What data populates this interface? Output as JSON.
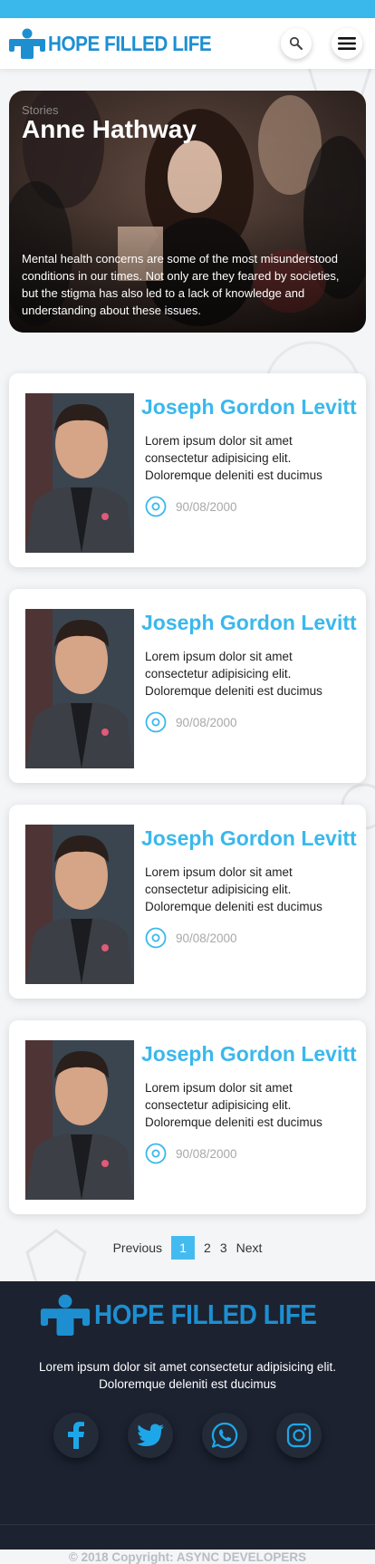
{
  "header": {
    "logo_text": "HOPE FILLED LIFE",
    "search_icon": "search-icon",
    "menu_icon": "hamburger-menu-icon"
  },
  "hero": {
    "kicker": "Stories",
    "title": "Anne Hathway",
    "description": "Mental health concerns are some of the most misunderstood conditions in our times. Not only are they feared by societies, but the stigma has also led to a lack of knowledge and understanding about these issues."
  },
  "cards": [
    {
      "name": "Joseph Gordon Levitt",
      "text": "Lorem ipsum dolor sit amet consectetur adipisicing elit. Doloremque deleniti est ducimus",
      "date": "90/08/2000"
    },
    {
      "name": "Joseph Gordon Levitt",
      "text": "Lorem ipsum dolor sit amet consectetur adipisicing elit. Doloremque deleniti est ducimus",
      "date": "90/08/2000"
    },
    {
      "name": "Joseph Gordon Levitt",
      "text": "Lorem ipsum dolor sit amet consectetur adipisicing elit. Doloremque deleniti est ducimus",
      "date": "90/08/2000"
    },
    {
      "name": "Joseph Gordon Levitt",
      "text": "Lorem ipsum dolor sit amet consectetur adipisicing elit. Doloremque deleniti est ducimus",
      "date": "90/08/2000"
    }
  ],
  "pagination": {
    "previous": "Previous",
    "pages": [
      "1",
      "2",
      "3"
    ],
    "next": "Next"
  },
  "footer": {
    "logo_text": "HOPE FILLED LIFE",
    "text": "Lorem ipsum dolor sit amet consectetur adipisicing elit. Doloremque deleniti est ducimus",
    "socials": [
      "facebook-icon",
      "twitter-icon",
      "whatsapp-icon",
      "instagram-icon"
    ],
    "copyright": "© 2018 Copyright: ASYNC DEVELOPERS"
  },
  "colors": {
    "accent": "#3ab8ec",
    "brand": "#1d8fd1",
    "footer_bg": "#1c2230",
    "page_bg": "#f4f5f7"
  }
}
